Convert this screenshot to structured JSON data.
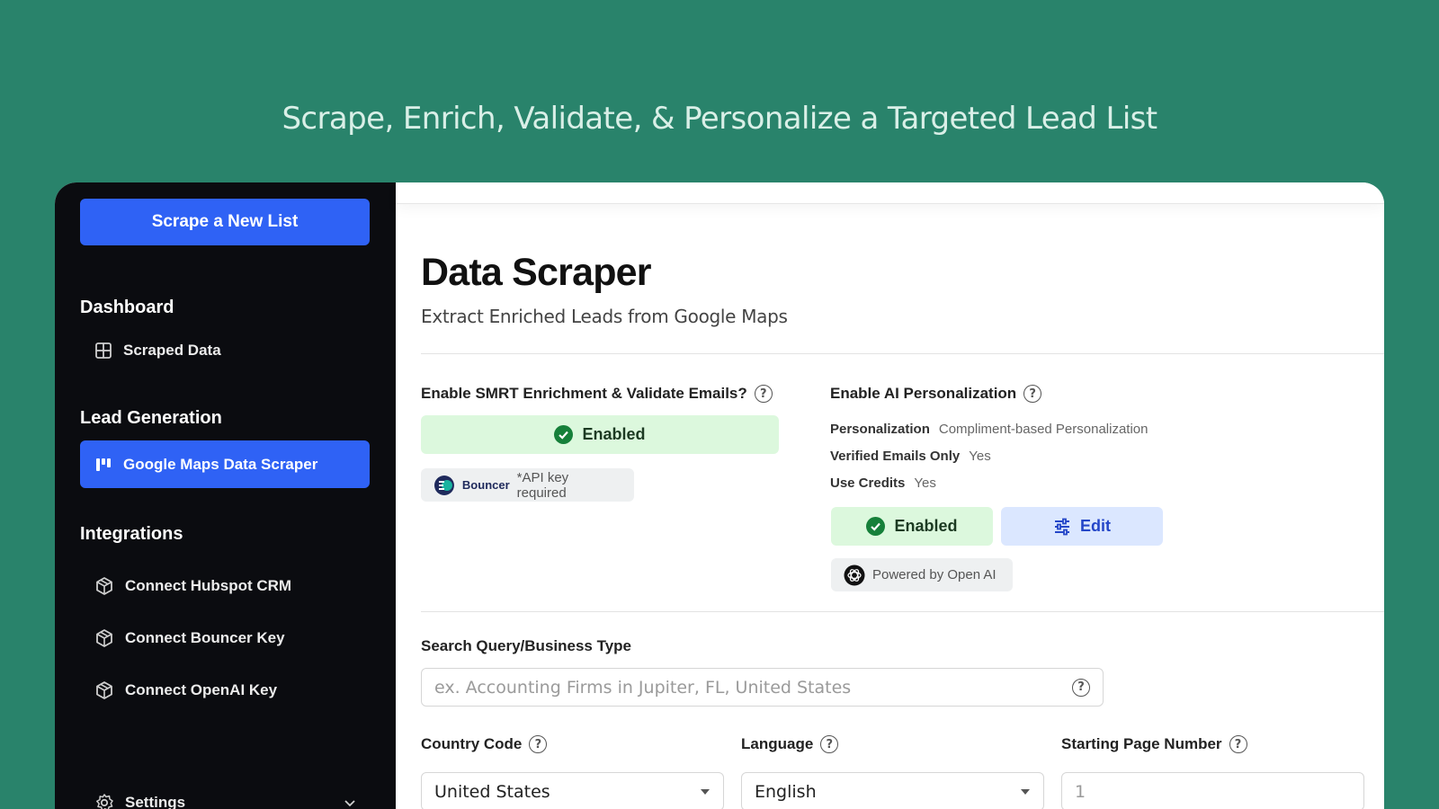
{
  "headline": "Scrape, Enrich, Validate, & Personalize a Targeted Lead List",
  "sidebar": {
    "primary_button": "Scrape a New List",
    "sections": [
      {
        "heading": "Dashboard",
        "items": [
          {
            "label": "Scraped Data",
            "icon": "grid-icon"
          }
        ]
      },
      {
        "heading": "Lead Generation",
        "items": [
          {
            "label": "Google Maps Data Scraper",
            "icon": "kanban-icon",
            "active": true
          }
        ]
      },
      {
        "heading": "Integrations",
        "items": [
          {
            "label": "Connect Hubspot CRM",
            "icon": "cube-icon"
          },
          {
            "label": "Connect Bouncer Key",
            "icon": "cube-icon"
          },
          {
            "label": "Connect OpenAI Key",
            "icon": "cube-icon"
          }
        ]
      }
    ],
    "settings_label": "Settings"
  },
  "main": {
    "title": "Data Scraper",
    "subtitle": "Extract Enriched Leads from Google Maps",
    "enrichment": {
      "label": "Enable SMRT Enrichment & Validate Emails?",
      "status": "Enabled",
      "provider_name": "Bouncer",
      "provider_note": "*API key required"
    },
    "ai": {
      "label": "Enable AI Personalization",
      "rows": [
        {
          "key": "Personalization",
          "value": "Compliment-based Personalization"
        },
        {
          "key": "Verified Emails Only",
          "value": "Yes"
        },
        {
          "key": "Use Credits",
          "value": "Yes"
        }
      ],
      "status": "Enabled",
      "edit_label": "Edit",
      "powered_by": "Powered by Open AI"
    },
    "search": {
      "label": "Search Query/Business Type",
      "placeholder": "ex. Accounting Firms in Jupiter, FL, United States"
    },
    "country": {
      "label": "Country Code",
      "value": "United States"
    },
    "language": {
      "label": "Language",
      "value": "English"
    },
    "start_page": {
      "label": "Starting Page Number",
      "placeholder": "1"
    }
  },
  "colors": {
    "background": "#29836b",
    "sidebar": "#0b0c10",
    "accent": "#2f62f5",
    "enabled_bg": "#dcf8dd",
    "enabled_check": "#16803a",
    "edit_bg": "#dbe7ff"
  }
}
